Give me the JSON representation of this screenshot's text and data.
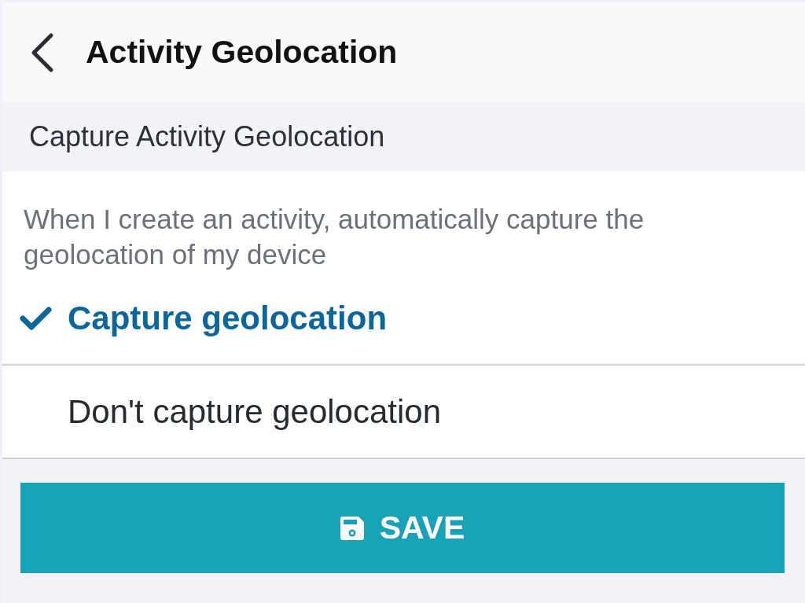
{
  "header": {
    "title": "Activity Geolocation"
  },
  "section": {
    "label": "Capture Activity Geolocation",
    "description": "When I create an activity, automatically capture the geolocation of my device",
    "options": [
      {
        "label": "Capture geolocation",
        "selected": true
      },
      {
        "label": "Don't capture geolocation",
        "selected": false
      }
    ]
  },
  "save_button": {
    "label": "SAVE"
  }
}
